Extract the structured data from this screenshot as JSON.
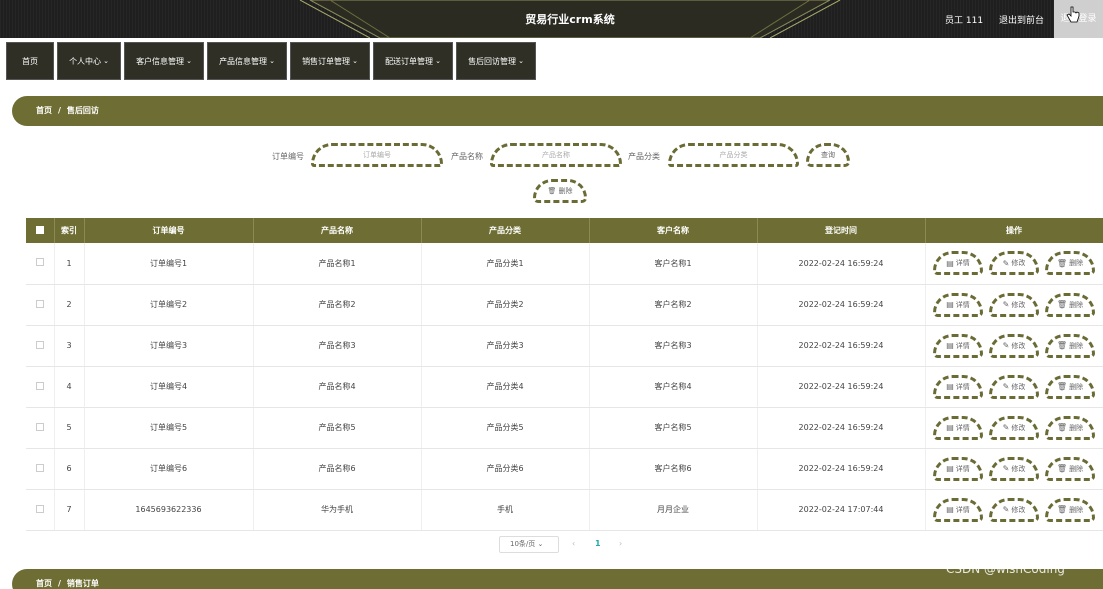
{
  "header": {
    "title": "贸易行业crm系统",
    "user": "员工 111",
    "back": "退出到前台",
    "logout": "退出登录"
  },
  "nav": [
    {
      "label": "首页"
    },
    {
      "label": "个人中心"
    },
    {
      "label": "客户信息管理"
    },
    {
      "label": "产品信息管理"
    },
    {
      "label": "销售订单管理"
    },
    {
      "label": "配送订单管理"
    },
    {
      "label": "售后回访管理"
    }
  ],
  "breadcrumb": {
    "home": "首页",
    "sep": "/",
    "current": "售后回访"
  },
  "breadcrumb2": {
    "home": "首页",
    "sep": "/",
    "current": "销售订单"
  },
  "search": {
    "order_label": "订单编号",
    "order_placeholder": "订单编号",
    "product_label": "产品名称",
    "product_placeholder": "产品名称",
    "category_label": "产品分类",
    "category_placeholder": "产品分类",
    "query_button": "查询",
    "delete_button": "删除"
  },
  "table": {
    "headers": [
      "索引",
      "订单编号",
      "产品名称",
      "产品分类",
      "客户名称",
      "登记时间",
      "操作"
    ],
    "rows": [
      {
        "index": "1",
        "order": "订单编号1",
        "product": "产品名称1",
        "category": "产品分类1",
        "customer": "客户名称1",
        "time": "2022-02-24 16:59:24"
      },
      {
        "index": "2",
        "order": "订单编号2",
        "product": "产品名称2",
        "category": "产品分类2",
        "customer": "客户名称2",
        "time": "2022-02-24 16:59:24"
      },
      {
        "index": "3",
        "order": "订单编号3",
        "product": "产品名称3",
        "category": "产品分类3",
        "customer": "客户名称3",
        "time": "2022-02-24 16:59:24"
      },
      {
        "index": "4",
        "order": "订单编号4",
        "product": "产品名称4",
        "category": "产品分类4",
        "customer": "客户名称4",
        "time": "2022-02-24 16:59:24"
      },
      {
        "index": "5",
        "order": "订单编号5",
        "product": "产品名称5",
        "category": "产品分类5",
        "customer": "客户名称5",
        "time": "2022-02-24 16:59:24"
      },
      {
        "index": "6",
        "order": "订单编号6",
        "product": "产品名称6",
        "category": "产品分类6",
        "customer": "客户名称6",
        "time": "2022-02-24 16:59:24"
      },
      {
        "index": "7",
        "order": "1645693622336",
        "product": "华为手机",
        "category": "手机",
        "customer": "月月企业",
        "time": "2022-02-24 17:07:44"
      }
    ],
    "ops": {
      "detail": "详情",
      "edit": "修改",
      "delete": "删除"
    }
  },
  "pager": {
    "page_size": "10条/页",
    "prev": "‹",
    "current": "1",
    "next": "›"
  },
  "watermark": "CSDN @wishCoding",
  "colors": {
    "accent": "#6e6e34",
    "topbar": "#1f1f1f",
    "nav": "#2f2f26"
  },
  "icons": [
    "cursor-icon",
    "caret-down-icon",
    "delete-icon",
    "detail-icon",
    "edit-icon"
  ]
}
